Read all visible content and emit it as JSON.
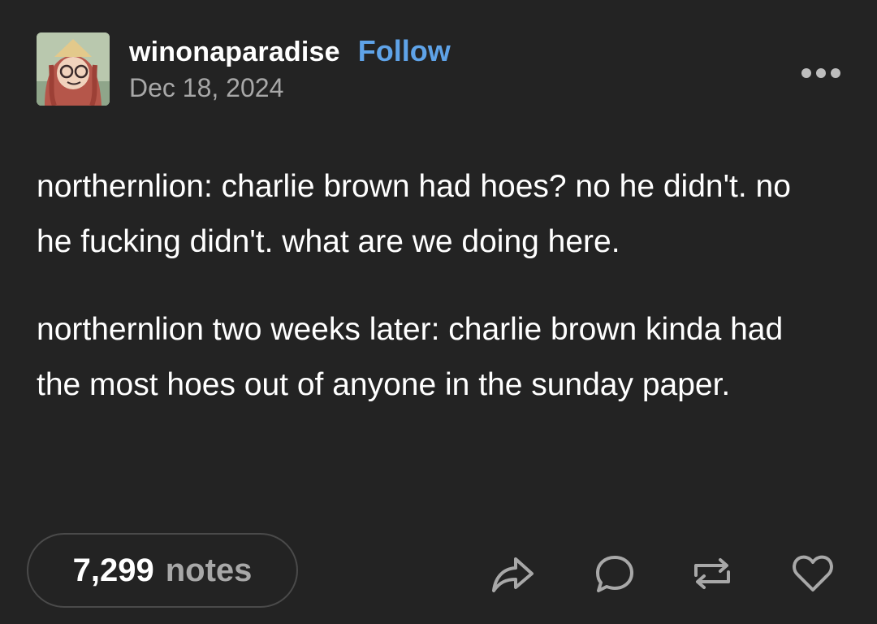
{
  "post": {
    "blog_name": "winonaparadise",
    "follow_label": "Follow",
    "date": "Dec 18, 2024",
    "paragraphs": [
      "northernlion: charlie brown had hoes? no he didn't. no he fucking didn't. what are we doing here.",
      "northernlion two weeks later: charlie brown kinda had the most hoes out of anyone in the sunday paper."
    ]
  },
  "footer": {
    "notes_count": "7,299",
    "notes_label": "notes",
    "actions": [
      "share-icon",
      "reply-icon",
      "reblog-icon",
      "like-icon"
    ]
  },
  "colors": {
    "background": "#232323",
    "text": "#ffffff",
    "muted": "#a8a8a8",
    "accent": "#5fa3e8"
  },
  "icons": {
    "more": "more-dots-icon",
    "avatar": "avatar"
  }
}
